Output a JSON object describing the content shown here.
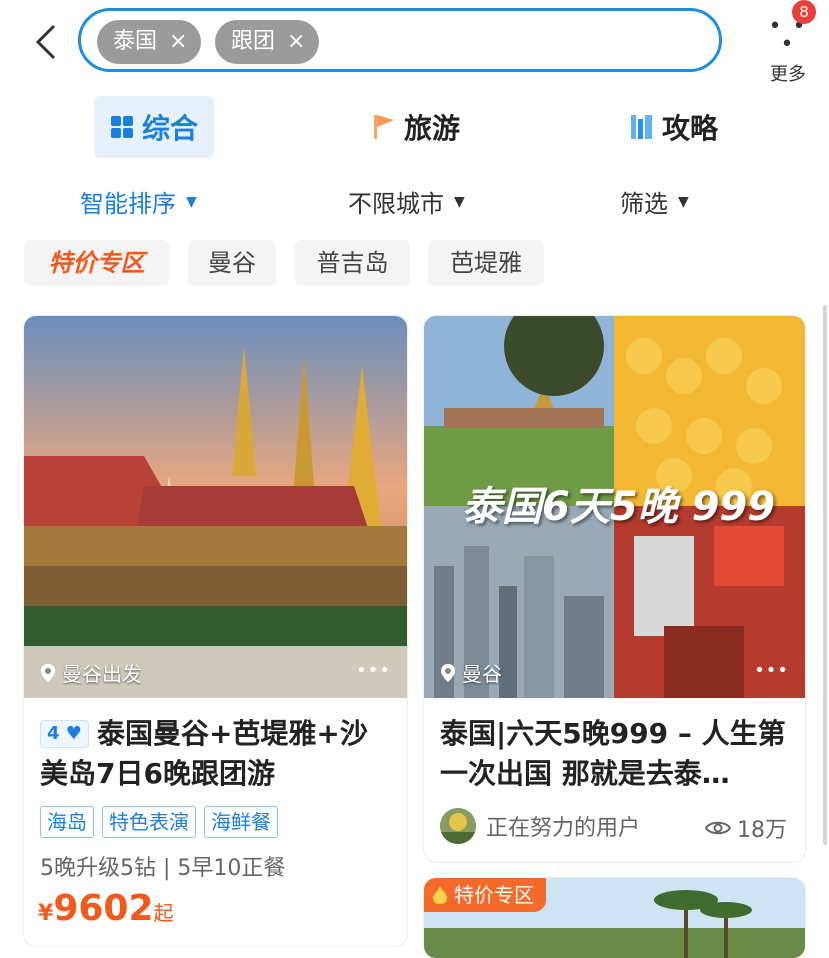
{
  "header": {
    "search_chips": [
      "泰国",
      "跟团"
    ],
    "chip_close": "×",
    "more_label": "更多",
    "more_badge": "8"
  },
  "tabs": [
    {
      "label": "综合",
      "icon": "grid-icon",
      "active": true
    },
    {
      "label": "旅游",
      "icon": "flag-icon"
    },
    {
      "label": "攻略",
      "icon": "book-icon"
    }
  ],
  "filters": [
    {
      "label": "智能排序",
      "active": true
    },
    {
      "label": "不限城市"
    },
    {
      "label": "筛选"
    }
  ],
  "quick_tags": [
    "特价专区",
    "曼谷",
    "普吉岛",
    "芭堤雅"
  ],
  "cards": [
    {
      "location": "曼谷出发",
      "level": "4",
      "title": "泰国曼谷+芭堤雅+沙美岛7日6晚跟团游",
      "tags": [
        "海岛",
        "特色表演",
        "海鲜餐"
      ],
      "subtitle": "5晚升级5钻 | 5早10正餐",
      "price_currency": "¥",
      "price": "9602",
      "price_suffix": "起"
    },
    {
      "location": "曼谷",
      "image_text": "泰国6天5晚 999",
      "title": "泰国|六天5晚999 – 人生第一次出国 那就是去泰…",
      "author": "正在努力的用户",
      "views": "18万"
    },
    {
      "badge": "特价专区"
    }
  ],
  "colors": {
    "accent": "#1b7fe0",
    "price": "#f05a1a",
    "badge": "#e8413b"
  }
}
